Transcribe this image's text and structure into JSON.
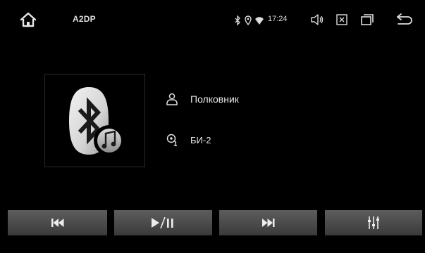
{
  "statusbar": {
    "app_title": "A2DP",
    "time": "17:24",
    "icons": [
      "home-icon",
      "bluetooth-icon",
      "location-icon",
      "wifi-icon",
      "volume-icon",
      "close-box-icon",
      "recent-apps-icon",
      "back-icon"
    ]
  },
  "track": {
    "title": "Полковник",
    "artist": "БИ-2",
    "title_icon": "person-icon",
    "artist_icon": "artist-mic-icon"
  },
  "album_art": {
    "icon": "bluetooth-music-icon"
  },
  "controls": [
    "previous-track-icon",
    "play-pause-icon",
    "next-track-icon",
    "equalizer-icon"
  ],
  "colors": {
    "background": "#000000",
    "button_top": "#5d5d5d",
    "button_bottom": "#3a3a3a",
    "text": "#e6e6e6"
  }
}
